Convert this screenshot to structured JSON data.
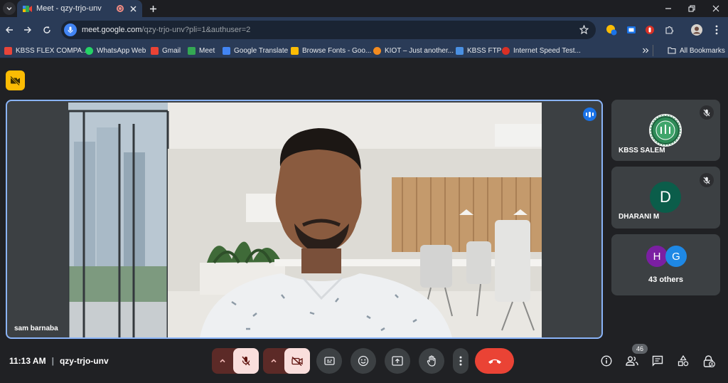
{
  "browser": {
    "tab": {
      "title": "Meet - qzy-trjo-unv"
    },
    "url": {
      "host": "meet.google.com",
      "path": "/qzy-trjo-unv?pli=1&authuser=2"
    },
    "bookmarks": [
      {
        "label": "KBSS FLEX COMPA...",
        "icon": "#e7453a"
      },
      {
        "label": "WhatsApp Web",
        "icon": "#25d366"
      },
      {
        "label": "Gmail",
        "icon": "#ea4335"
      },
      {
        "label": "Meet",
        "icon": "#34a853"
      },
      {
        "label": "Google Translate",
        "icon": "#4285f4"
      },
      {
        "label": "Browse Fonts - Goo...",
        "icon": "#fbbc04"
      },
      {
        "label": "KIOT – Just another...",
        "icon": "#f28b20"
      },
      {
        "label": "KBSS FTP",
        "icon": "#4a90e2"
      },
      {
        "label": "Internet Speed Test...",
        "icon": "#d93025"
      }
    ],
    "all_bookmarks": "All Bookmarks"
  },
  "meet": {
    "main_speaker": {
      "name": "sam barnaba"
    },
    "participants": [
      {
        "name": "KBSS SALEM",
        "muted": true
      },
      {
        "name": "DHARANI M",
        "initial": "D",
        "color": "#0b5d4a",
        "muted": true
      }
    ],
    "others": {
      "label": "43 others",
      "avatars": [
        {
          "initial": "H",
          "color": "#7b1fa2"
        },
        {
          "initial": "G",
          "color": "#1e88e5"
        }
      ]
    },
    "time": "11:13 AM",
    "meeting_code": "qzy-trjo-unv",
    "people_count": "46",
    "colors": {
      "accent": "#8ab4f8",
      "danger": "#ea4335",
      "off_button": "#f9dedc",
      "expand_button": "#5c2a27"
    }
  }
}
